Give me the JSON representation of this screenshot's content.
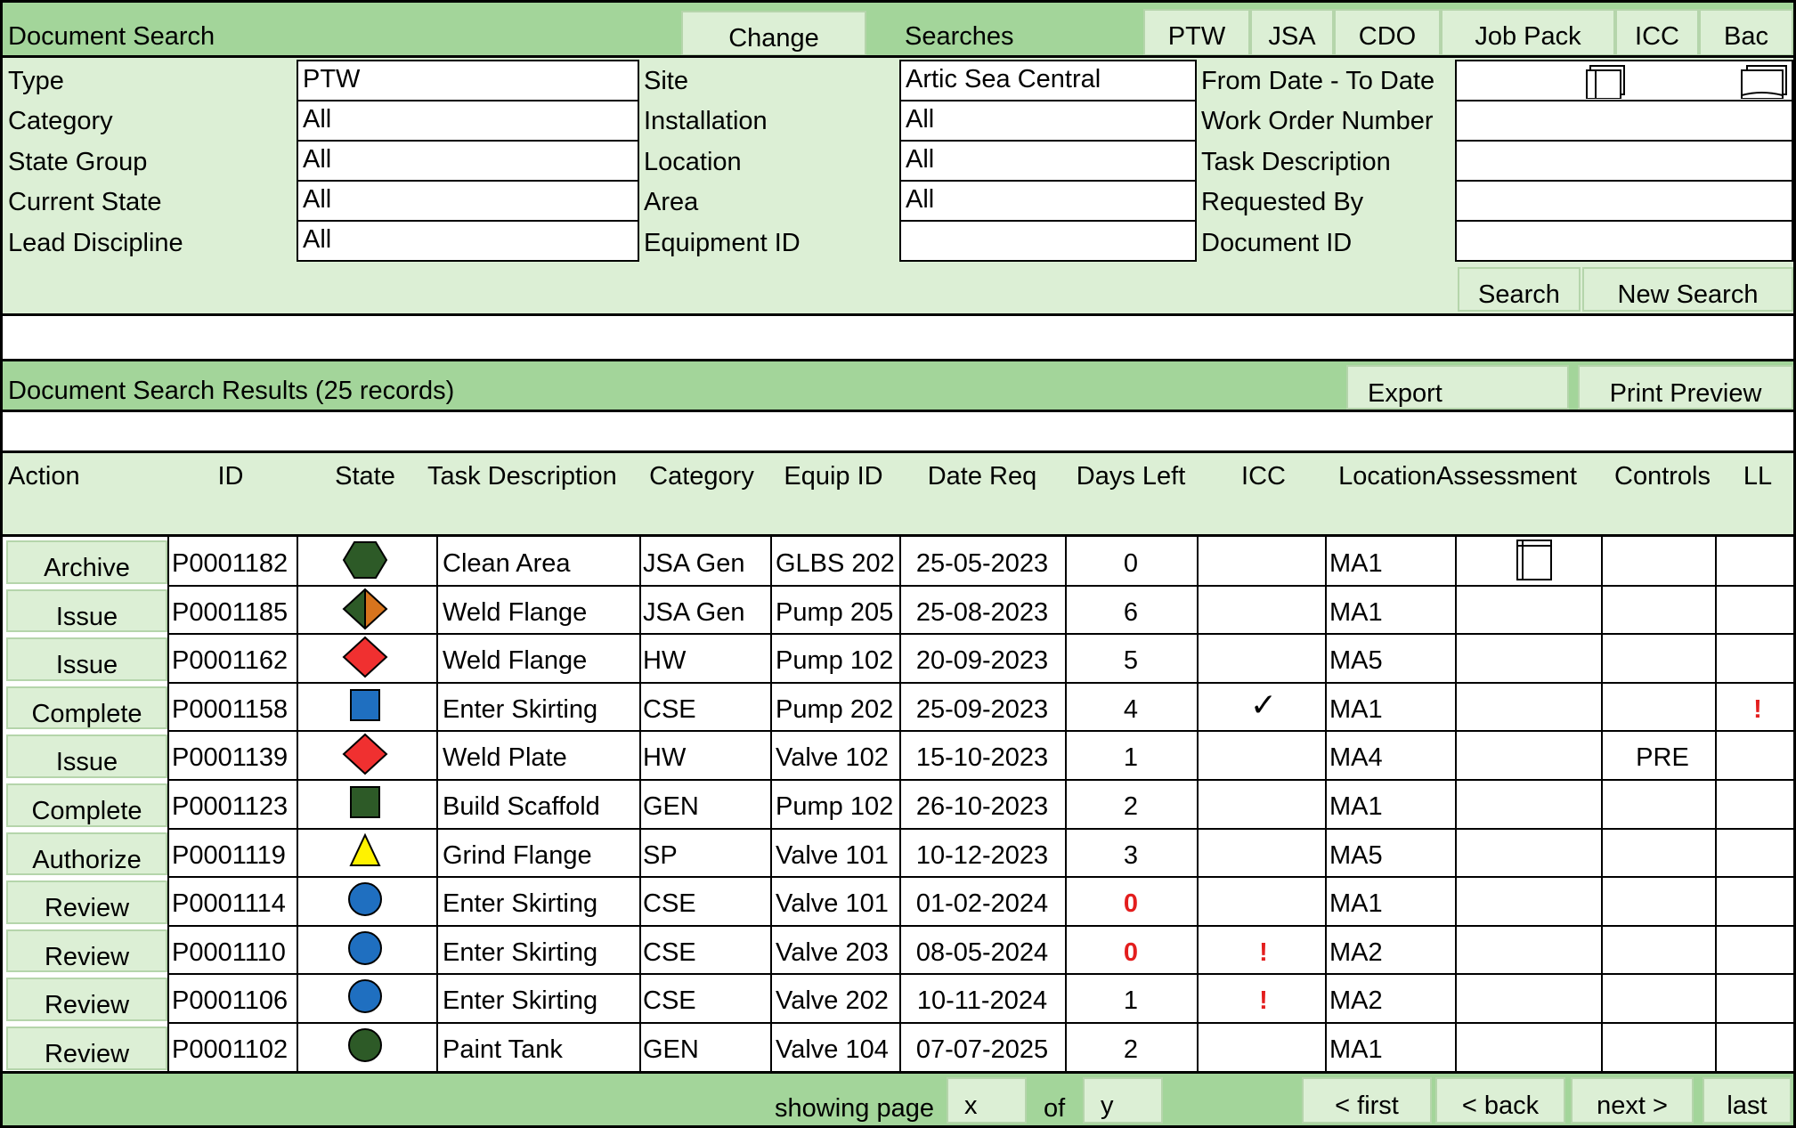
{
  "search": {
    "title": "Document Search",
    "change_button": "Change",
    "searches_label": "Searches",
    "tabs": [
      "PTW",
      "JSA",
      "CDO",
      "Job Pack",
      "ICC",
      "Bac"
    ],
    "left_labels": [
      "Type",
      "Category",
      "State Group",
      "Current State",
      "Lead Discipline"
    ],
    "left_values": [
      "PTW",
      "All",
      "All",
      "All",
      "All"
    ],
    "mid_labels": [
      "Site",
      "Installation",
      "Location",
      "Area",
      "Equipment ID"
    ],
    "mid_values": [
      "Artic Sea Central",
      "All",
      "All",
      "All",
      ""
    ],
    "right_labels": [
      "From Date - To Date",
      "Work Order Number",
      "Task Description",
      "Requested By",
      "Document ID"
    ],
    "search_button": "Search",
    "new_search_button": "New Search"
  },
  "results": {
    "title": "Document Search Results (25 records)",
    "export_button": "Export",
    "print_preview_button": "Print Preview",
    "columns": [
      "Action",
      "ID",
      "State",
      "Task Description",
      "Category",
      "Equip ID",
      "Date Req",
      "Days Left",
      "ICC",
      "Location",
      "Assessment",
      "Controls",
      "LL"
    ],
    "rows": [
      {
        "action": "Archive",
        "id": "P0001182",
        "state": "hexagon",
        "state_color": "#2d5a27",
        "task": "Clean Area",
        "category": "JSA Gen",
        "equip": "GLBS 202",
        "date": "25-05-2023",
        "days": "0",
        "days_red": false,
        "icc": "",
        "location": "MA1",
        "assessment": "doc",
        "controls": "",
        "ll": ""
      },
      {
        "action": "Issue",
        "id": "P0001185",
        "state": "diamond-split",
        "state_color": "#2d5a27",
        "task": "Weld Flange",
        "category": "JSA Gen",
        "equip": "Pump 205",
        "date": "25-08-2023",
        "days": "6",
        "days_red": false,
        "icc": "",
        "location": "MA1",
        "assessment": "",
        "controls": "",
        "ll": ""
      },
      {
        "action": "Issue",
        "id": "P0001162",
        "state": "diamond",
        "state_color": "#f03030",
        "task": "Weld Flange",
        "category": "HW",
        "equip": "Pump 102",
        "date": "20-09-2023",
        "days": "5",
        "days_red": false,
        "icc": "",
        "location": "MA5",
        "assessment": "",
        "controls": "",
        "ll": ""
      },
      {
        "action": "Complete",
        "id": "P0001158",
        "state": "square",
        "state_color": "#1f6fc0",
        "task": "Enter Skirting",
        "category": "CSE",
        "equip": "Pump 202",
        "date": "25-09-2023",
        "days": "4",
        "days_red": false,
        "icc": "✓",
        "location": "MA1",
        "assessment": "",
        "controls": "",
        "ll": "!"
      },
      {
        "action": "Issue",
        "id": "P0001139",
        "state": "diamond",
        "state_color": "#f03030",
        "task": "Weld Plate",
        "category": "HW",
        "equip": "Valve 102",
        "date": "15-10-2023",
        "days": "1",
        "days_red": false,
        "icc": "",
        "location": "MA4",
        "assessment": "",
        "controls": "PRE",
        "ll": ""
      },
      {
        "action": "Complete",
        "id": "P0001123",
        "state": "square",
        "state_color": "#2d5a27",
        "task": "Build Scaffold",
        "category": "GEN",
        "equip": "Pump 102",
        "date": "26-10-2023",
        "days": "2",
        "days_red": false,
        "icc": "",
        "location": "MA1",
        "assessment": "",
        "controls": "",
        "ll": ""
      },
      {
        "action": "Authorize",
        "id": "P0001119",
        "state": "triangle",
        "state_color": "#fff200",
        "task": "Grind Flange",
        "category": "SP",
        "equip": "Valve 101",
        "date": "10-12-2023",
        "days": "3",
        "days_red": false,
        "icc": "",
        "location": "MA5",
        "assessment": "",
        "controls": "",
        "ll": ""
      },
      {
        "action": "Review",
        "id": "P0001114",
        "state": "circle",
        "state_color": "#1f6fc0",
        "task": "Enter Skirting",
        "category": "CSE",
        "equip": "Valve 101",
        "date": "01-02-2024",
        "days": "0",
        "days_red": true,
        "icc": "",
        "location": "MA1",
        "assessment": "",
        "controls": "",
        "ll": ""
      },
      {
        "action": "Review",
        "id": "P0001110",
        "state": "circle",
        "state_color": "#1f6fc0",
        "task": "Enter Skirting",
        "category": "CSE",
        "equip": "Valve 203",
        "date": "08-05-2024",
        "days": "0",
        "days_red": true,
        "icc": "!",
        "location": "MA2",
        "assessment": "",
        "controls": "",
        "ll": ""
      },
      {
        "action": "Review",
        "id": "P0001106",
        "state": "circle",
        "state_color": "#1f6fc0",
        "task": "Enter Skirting",
        "category": "CSE",
        "equip": "Valve 202",
        "date": "10-11-2024",
        "days": "1",
        "days_red": false,
        "icc": "!",
        "location": "MA2",
        "assessment": "",
        "controls": "",
        "ll": ""
      },
      {
        "action": "Review",
        "id": "P0001102",
        "state": "circle",
        "state_color": "#2d5a27",
        "task": "Paint Tank",
        "category": "GEN",
        "equip": "Valve 104",
        "date": "07-07-2025",
        "days": "2",
        "days_red": false,
        "icc": "",
        "location": "MA1",
        "assessment": "",
        "controls": "",
        "ll": ""
      }
    ]
  },
  "pager": {
    "showing_page": "showing page",
    "page_x": "x",
    "of": "of",
    "page_y": "y",
    "first": "< first",
    "back": "< back",
    "next": "next >",
    "last": "last"
  },
  "colors": {
    "bar": "#a3d59a",
    "panel": "#dcefd5",
    "alert": "#e31e1e"
  }
}
